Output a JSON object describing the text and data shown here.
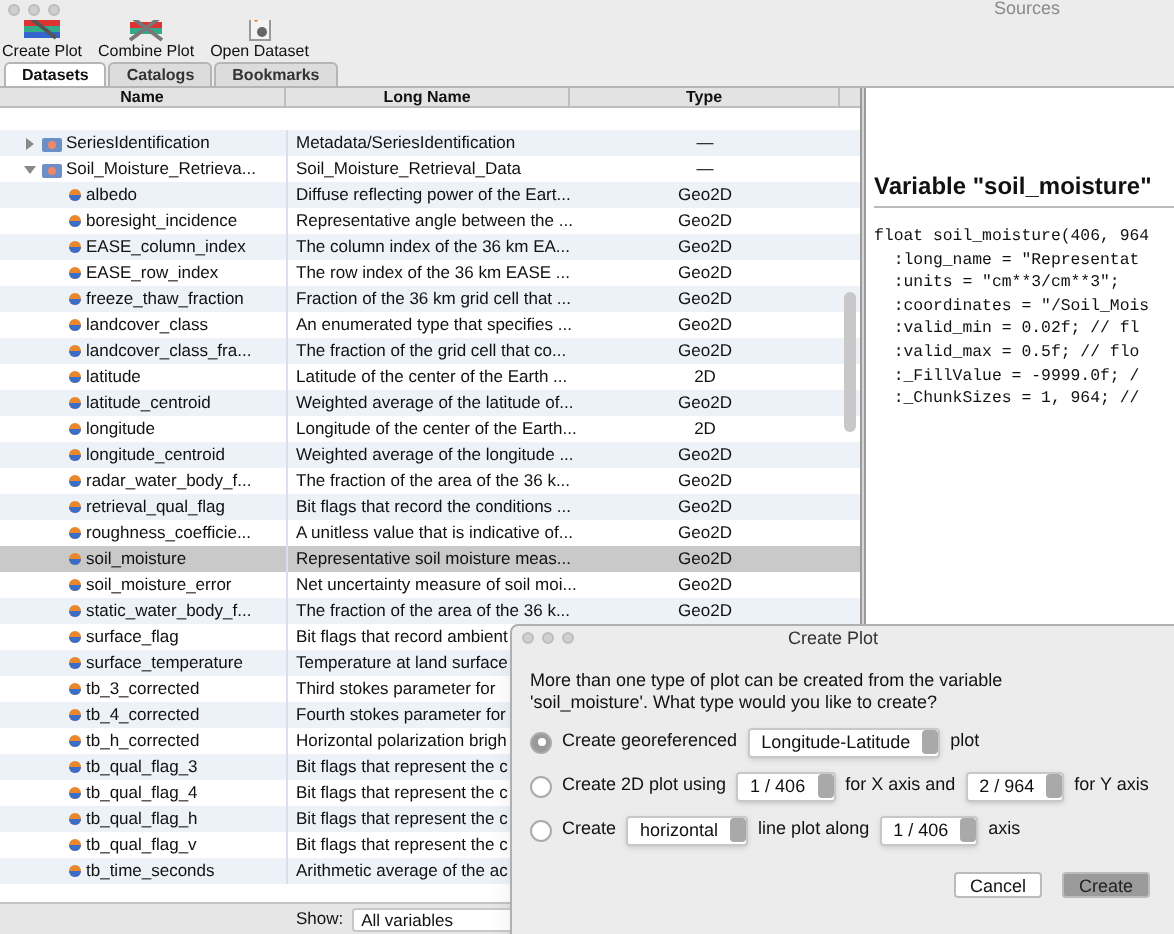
{
  "window": {
    "title": "Sources"
  },
  "toolbar": [
    {
      "label": "Create Plot",
      "kind": "create"
    },
    {
      "label": "Combine Plot",
      "kind": "combine"
    },
    {
      "label": "Open Dataset",
      "kind": "open"
    }
  ],
  "tabs": [
    {
      "label": "Datasets",
      "selected": true
    },
    {
      "label": "Catalogs",
      "selected": false
    },
    {
      "label": "Bookmarks",
      "selected": false
    }
  ],
  "table": {
    "columns": [
      "Name",
      "Long Name",
      "Type"
    ],
    "rows": [
      {
        "name": "SeriesIdentification",
        "long_name": "Metadata/SeriesIdentification",
        "type": "—",
        "kind": "group",
        "expanded": false,
        "selected": false
      },
      {
        "name": "Soil_Moisture_Retrieva...",
        "long_name": "Soil_Moisture_Retrieval_Data",
        "type": "—",
        "kind": "group",
        "expanded": true,
        "selected": false,
        "children": [
          {
            "name": "albedo",
            "long_name": "Diffuse reflecting power of the Eart...",
            "type": "Geo2D",
            "kind": "variable",
            "selected": false
          },
          {
            "name": "boresight_incidence",
            "long_name": "Representative angle between the ...",
            "type": "Geo2D",
            "kind": "variable",
            "selected": false
          },
          {
            "name": "EASE_column_index",
            "long_name": "The column index of the 36 km EA...",
            "type": "Geo2D",
            "kind": "variable",
            "selected": false
          },
          {
            "name": "EASE_row_index",
            "long_name": "The row index of the 36 km EASE ...",
            "type": "Geo2D",
            "kind": "variable",
            "selected": false
          },
          {
            "name": "freeze_thaw_fraction",
            "long_name": "Fraction of the 36 km grid cell that ...",
            "type": "Geo2D",
            "kind": "variable",
            "selected": false
          },
          {
            "name": "landcover_class",
            "long_name": "An enumerated type that specifies ...",
            "type": "Geo2D",
            "kind": "variable",
            "selected": false
          },
          {
            "name": "landcover_class_fra...",
            "long_name": "The fraction of the grid cell that co...",
            "type": "Geo2D",
            "kind": "variable",
            "selected": false
          },
          {
            "name": "latitude",
            "long_name": "Latitude of the center of the Earth ...",
            "type": "2D",
            "kind": "variable",
            "selected": false
          },
          {
            "name": "latitude_centroid",
            "long_name": "Weighted average of the latitude of...",
            "type": "Geo2D",
            "kind": "variable",
            "selected": false
          },
          {
            "name": "longitude",
            "long_name": "Longitude of the center of the Earth...",
            "type": "2D",
            "kind": "variable",
            "selected": false
          },
          {
            "name": "longitude_centroid",
            "long_name": "Weighted average of the longitude ...",
            "type": "Geo2D",
            "kind": "variable",
            "selected": false
          },
          {
            "name": "radar_water_body_f...",
            "long_name": "The fraction of the area of the 36 k...",
            "type": "Geo2D",
            "kind": "variable",
            "selected": false
          },
          {
            "name": "retrieval_qual_flag",
            "long_name": "Bit flags that record the conditions ...",
            "type": "Geo2D",
            "kind": "variable",
            "selected": false
          },
          {
            "name": "roughness_coefficie...",
            "long_name": "A unitless value that is indicative of...",
            "type": "Geo2D",
            "kind": "variable",
            "selected": false
          },
          {
            "name": "soil_moisture",
            "long_name": "Representative soil moisture meas...",
            "type": "Geo2D",
            "kind": "variable",
            "selected": true
          },
          {
            "name": "soil_moisture_error",
            "long_name": "Net uncertainty measure of soil moi...",
            "type": "Geo2D",
            "kind": "variable",
            "selected": false
          },
          {
            "name": "static_water_body_f...",
            "long_name": "The fraction of the area of the 36 k...",
            "type": "Geo2D",
            "kind": "variable",
            "selected": false
          },
          {
            "name": "surface_flag",
            "long_name": "Bit flags that record ambient",
            "kind": "variable",
            "selected": false
          },
          {
            "name": "surface_temperature",
            "long_name": "Temperature at land surface",
            "kind": "variable",
            "selected": false
          },
          {
            "name": "tb_3_corrected",
            "long_name": "Third stokes parameter for",
            "kind": "variable",
            "selected": false
          },
          {
            "name": "tb_4_corrected",
            "long_name": "Fourth stokes parameter for",
            "kind": "variable",
            "selected": false
          },
          {
            "name": "tb_h_corrected",
            "long_name": "Horizontal polarization brigh",
            "kind": "variable",
            "selected": false
          },
          {
            "name": "tb_qual_flag_3",
            "long_name": "Bit flags that represent the c",
            "kind": "variable",
            "selected": false
          },
          {
            "name": "tb_qual_flag_4",
            "long_name": "Bit flags that represent the c",
            "kind": "variable",
            "selected": false
          },
          {
            "name": "tb_qual_flag_h",
            "long_name": "Bit flags that represent the c",
            "kind": "variable",
            "selected": false
          },
          {
            "name": "tb_qual_flag_v",
            "long_name": "Bit flags that represent the c",
            "kind": "variable",
            "selected": false
          },
          {
            "name": "tb_time_seconds",
            "long_name": "Arithmetic average of the ac",
            "kind": "variable",
            "selected": false
          }
        ]
      }
    ]
  },
  "show": {
    "label": "Show:",
    "value": "All variables"
  },
  "details": {
    "title": "Variable \"soil_moisture\"",
    "lines": [
      "float soil_moisture(406, 964",
      "  :long_name = \"Representat",
      "  :units = \"cm**3/cm**3\";",
      "  :coordinates = \"/Soil_Mois",
      "  :valid_min = 0.02f; // fl",
      "  :valid_max = 0.5f; // flo",
      "  :_FillValue = -9999.0f; /",
      "  :_ChunkSizes = 1, 964; //"
    ]
  },
  "dialog": {
    "title": "Create Plot",
    "message": "More than one type of plot can be created from the variable 'soil_moisture'. What type would you like to create?",
    "options": [
      {
        "selected": true,
        "parts": [
          {
            "kind": "text",
            "text": "Create georeferenced"
          },
          {
            "kind": "select",
            "text": "Longitude-Latitude"
          },
          {
            "kind": "text",
            "text": "plot"
          }
        ]
      },
      {
        "selected": false,
        "parts": [
          {
            "kind": "text",
            "text": "Create 2D plot using"
          },
          {
            "kind": "select",
            "text": "1 / 406"
          },
          {
            "kind": "text",
            "text": "for X axis and"
          },
          {
            "kind": "select",
            "text": "2 / 964"
          },
          {
            "kind": "text",
            "text": "for Y axis"
          }
        ]
      },
      {
        "selected": false,
        "parts": [
          {
            "kind": "text",
            "text": "Create"
          },
          {
            "kind": "select",
            "text": "horizontal"
          },
          {
            "kind": "text",
            "text": "line plot along"
          },
          {
            "kind": "select",
            "text": "1 / 406"
          },
          {
            "kind": "text",
            "text": "axis"
          }
        ]
      }
    ],
    "buttons": [
      {
        "label": "Cancel",
        "kind": "secondary"
      },
      {
        "label": "Create",
        "kind": "default"
      }
    ]
  }
}
